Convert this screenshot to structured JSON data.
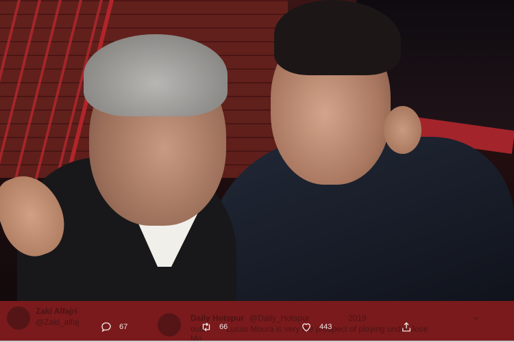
{
  "tweet_background": {
    "author_name": "Zaki Alfajri",
    "author_handle": "@Zaki_alfaj",
    "reply_author": "Daily Hotspur",
    "reply_handle": "@Daily_Hotspur",
    "reply_date": "2019",
    "reply_text_fragment": "Lucas Moura is very the prospect of playing under Jose",
    "reply_text_start": "ould",
    "reply_text_line2": "Mo"
  },
  "actions": {
    "reply_count": "67",
    "retweet_count": "66",
    "like_count": "443"
  },
  "icons": {
    "reply": "reply-icon",
    "retweet": "retweet-icon",
    "like": "heart-icon",
    "share": "share-icon"
  },
  "colors": {
    "bar_background": "#7a1a1c",
    "action_text": "#f3e9e6"
  }
}
